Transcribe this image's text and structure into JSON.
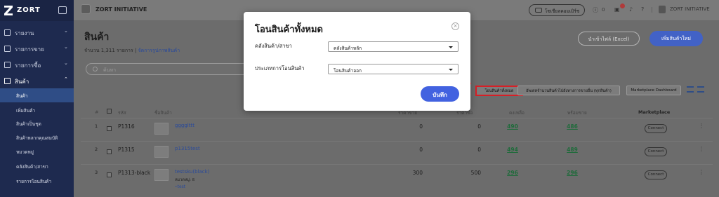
{
  "sidebar": {
    "brand": "ZORT",
    "items": [
      {
        "label": "รายงาน",
        "chevron": "⌄"
      },
      {
        "label": "รายการขาย",
        "chevron": "⌄"
      },
      {
        "label": "รายการซื้อ",
        "chevron": "⌄"
      },
      {
        "label": "สินค้า",
        "chevron": "⌃"
      }
    ],
    "sub_items": [
      {
        "label": "สินค้า"
      },
      {
        "label": "เพิ่มสินค้า"
      },
      {
        "label": "สินค้าเป็นชุด"
      },
      {
        "label": "สินค้าหลากคุณสมบัติ"
      },
      {
        "label": "หมวดหมู่"
      },
      {
        "label": "คลังสินค้า/สาขา"
      },
      {
        "label": "รายการโอนสินค้า"
      }
    ]
  },
  "topbar": {
    "workspace": "ZORT INITIATIVE",
    "live_button": "โซเชียลคอมเมิร์ช",
    "credit_count": "0",
    "notif_count": "1",
    "user_name": "ZORT INITIATIVE"
  },
  "page": {
    "title": "สินค้า",
    "count_text": "จำนวน 1,311 รายการ | ",
    "manage_link": "จัดการรูปภาพสินค้า",
    "import_button": "นำเข้าไฟล์ (Excel)",
    "add_button": "เพิ่มสินค้าใหม่",
    "search_placeholder": "ค้นหา",
    "all_stock_button": "โอนสินค้าทั้งหมด",
    "sync_button": "อัพเดทจำนวนสินค้าไปยังทางการขายอื่น (ทุกสินค้า)",
    "mp_dashboard_button": "Marketplace Dashboard"
  },
  "table": {
    "headers": {
      "no": "#",
      "sku": "รหัส",
      "name": "ชื่อสินค้า",
      "col_a": "ราคาขาย",
      "col_b": "ราคาซื้อ",
      "remaining": "คงเหลือ",
      "available": "พร้อมขาย",
      "marketplace": "Marketplace"
    },
    "rows": [
      {
        "no": "1",
        "sku": "P1316",
        "name": "gggglttt",
        "extra": "",
        "tag": "",
        "col_a": "0",
        "col_b": "0",
        "remaining": "490",
        "available": "486",
        "connect": "Connect",
        "more": "⋮"
      },
      {
        "no": "2",
        "sku": "P1315",
        "name": "p1315test",
        "extra": "",
        "tag": "",
        "col_a": "0",
        "col_b": "0",
        "remaining": "494",
        "available": "489",
        "connect": "Connect",
        "more": "⋮"
      },
      {
        "no": "3",
        "sku": "P1313-black",
        "name": "testsku(black)",
        "extra": "หมวดหมู่: ß",
        "tag": "test",
        "col_a": "300",
        "col_b": "500",
        "remaining": "296",
        "available": "296",
        "connect": "Connect",
        "more": "⋮"
      }
    ]
  },
  "modal": {
    "title": "โอนสินค้าทั้งหมด",
    "close": "×",
    "warehouse_label": "คลังสินค้า/สาขา",
    "warehouse_value": "คลังสินค้าหลัก",
    "type_label": "ประเภทการโอนสินค้า",
    "type_value": "โอนสินค้าออก",
    "save_button": "บันทึก"
  },
  "colors": {
    "primary": "#4262e0",
    "sidebar": "#1e2a4f",
    "highlight": "#d81f26"
  }
}
